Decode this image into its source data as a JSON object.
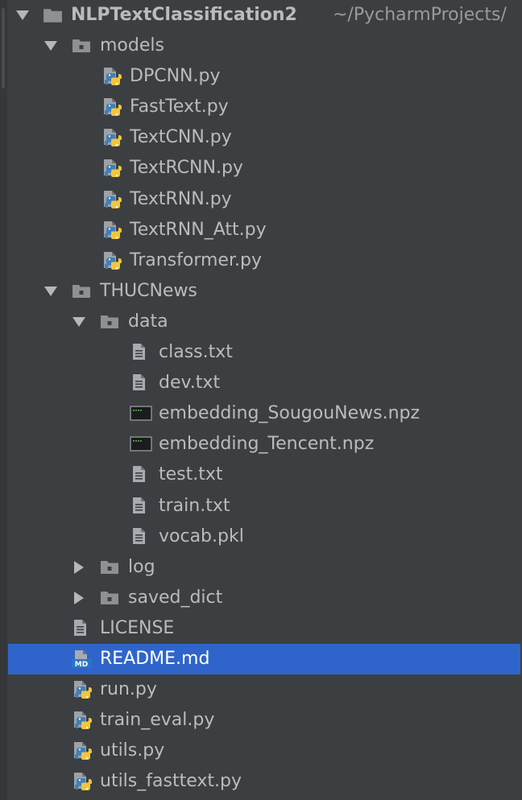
{
  "project": {
    "name": "NLPTextClassification2",
    "path": "~/PycharmProjects/"
  },
  "tree": [
    {
      "label": "models",
      "icon": "folder-icon",
      "expanded": true
    },
    {
      "label": "DPCNN.py",
      "icon": "python-file-icon"
    },
    {
      "label": "FastText.py",
      "icon": "python-file-icon"
    },
    {
      "label": "TextCNN.py",
      "icon": "python-file-icon"
    },
    {
      "label": "TextRCNN.py",
      "icon": "python-file-icon"
    },
    {
      "label": "TextRNN.py",
      "icon": "python-file-icon"
    },
    {
      "label": "TextRNN_Att.py",
      "icon": "python-file-icon"
    },
    {
      "label": "Transformer.py",
      "icon": "python-file-icon"
    },
    {
      "label": "THUCNews",
      "icon": "folder-icon",
      "expanded": true
    },
    {
      "label": "data",
      "icon": "folder-icon",
      "expanded": true
    },
    {
      "label": "class.txt",
      "icon": "text-file-icon"
    },
    {
      "label": "dev.txt",
      "icon": "text-file-icon"
    },
    {
      "label": "embedding_SougouNews.npz",
      "icon": "binary-file-icon"
    },
    {
      "label": "embedding_Tencent.npz",
      "icon": "binary-file-icon"
    },
    {
      "label": "test.txt",
      "icon": "text-file-icon"
    },
    {
      "label": "train.txt",
      "icon": "text-file-icon"
    },
    {
      "label": "vocab.pkl",
      "icon": "text-file-icon"
    },
    {
      "label": "log",
      "icon": "folder-icon",
      "expanded": false
    },
    {
      "label": "saved_dict",
      "icon": "folder-icon",
      "expanded": false
    },
    {
      "label": "LICENSE",
      "icon": "text-file-icon"
    },
    {
      "label": "README.md",
      "icon": "markdown-file-icon",
      "selected": true
    },
    {
      "label": "run.py",
      "icon": "python-file-icon"
    },
    {
      "label": "train_eval.py",
      "icon": "python-file-icon"
    },
    {
      "label": "utils.py",
      "icon": "python-file-icon"
    },
    {
      "label": "utils_fasttext.py",
      "icon": "python-file-icon"
    }
  ],
  "colors": {
    "background": "#3c3f41",
    "text": "#bbbbbb",
    "selection": "#2f65ca",
    "python_blue": "#3f7fb8",
    "python_yellow": "#f2c53d"
  }
}
